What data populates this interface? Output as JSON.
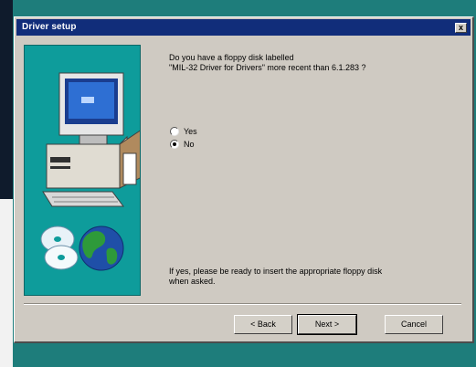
{
  "window": {
    "title": "Driver setup",
    "close_glyph": "x"
  },
  "content": {
    "question_line1": "Do you have a floppy disk labelled",
    "question_line2": "\"MIL-32 Driver for Drivers\" more recent than 6.1.283 ?",
    "options": [
      {
        "label": "Yes",
        "selected": false
      },
      {
        "label": "No",
        "selected": true
      }
    ],
    "instruction_line1": "If yes, please be ready to insert the appropriate floppy disk",
    "instruction_line2": "when asked."
  },
  "buttons": {
    "back": "< Back",
    "next": "Next >",
    "cancel": "Cancel"
  },
  "colors": {
    "desktop": "#1e7d7b",
    "titlebar": "#112d7a",
    "dialog_face": "#cfcac2",
    "sidebar": "#0e9c9b"
  },
  "icons": [
    "computer-icon",
    "cd-globe-icon",
    "close-icon"
  ]
}
